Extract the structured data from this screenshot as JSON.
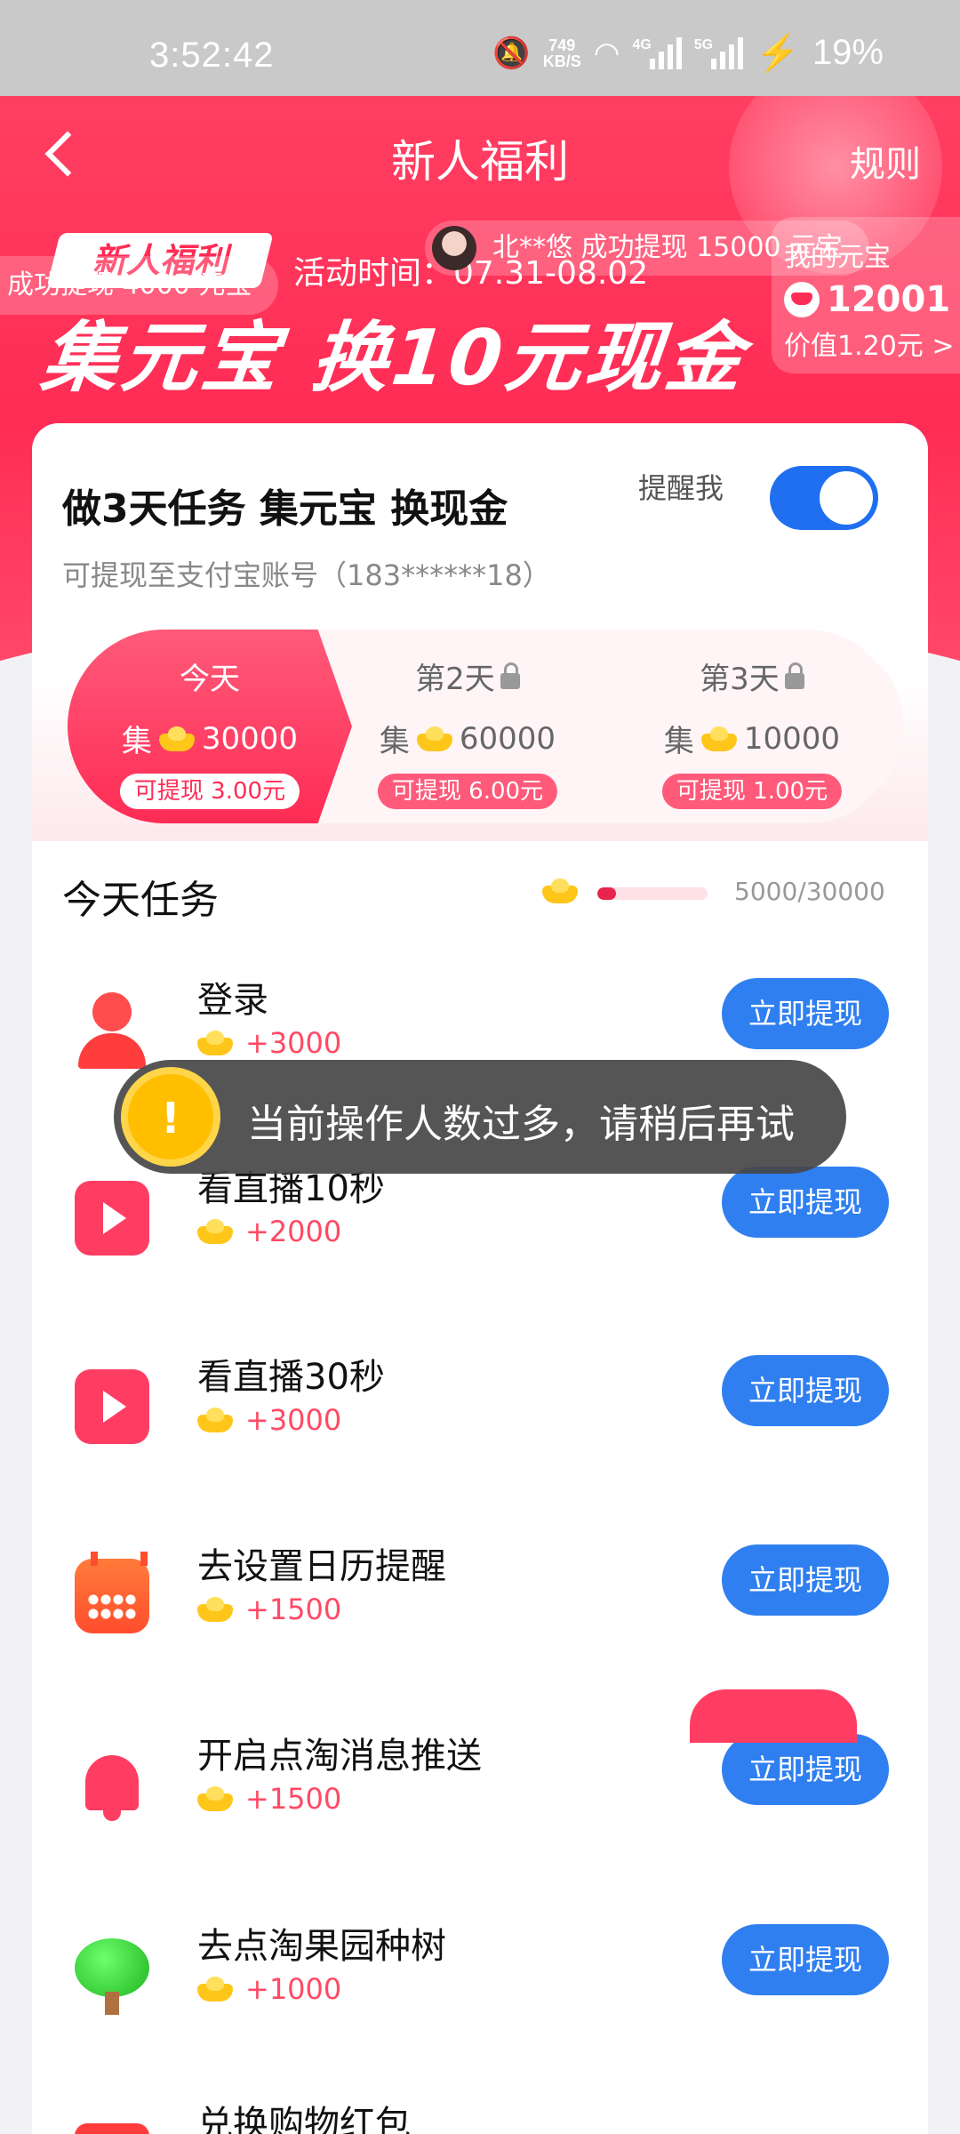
{
  "status_bar": {
    "time": "3:52:42",
    "net_speed_value": "749",
    "net_speed_unit": "KB/S",
    "network_4g": "4G",
    "network_5g": "5G",
    "battery": "19%"
  },
  "header": {
    "title": "新人福利",
    "rules": "规则"
  },
  "banner": {
    "badge": "新人福利",
    "ticker_left": "成功提现 4000 元宝",
    "activity_time": "活动时间：07.31-08.02",
    "ticker_right": "北**悠 成功提现 15000 元宝",
    "headline": "集元宝 换10元现金",
    "my_yuanbao_label": "我的元宝",
    "my_yuanbao_amount": "12001",
    "my_yuanbao_value": "价值1.20元 >"
  },
  "task_card": {
    "title": "做3天任务 集元宝 换现金",
    "subtitle": "可提现至支付宝账号（183******18）",
    "remind_label": "提醒我",
    "remind_on": true,
    "days": [
      {
        "name": "今天",
        "prefix": "集",
        "amount": "30000",
        "cash": "可提现 3.00元",
        "locked": false
      },
      {
        "name": "第2天",
        "prefix": "集",
        "amount": "60000",
        "cash": "可提现 6.00元",
        "locked": true
      },
      {
        "name": "第3天",
        "prefix": "集",
        "amount": "10000",
        "cash": "可提现 1.00元",
        "locked": true
      }
    ],
    "today_tasks_title": "今天任务",
    "progress": {
      "current": 5000,
      "total": 30000,
      "text": "5000/30000"
    }
  },
  "tasks": [
    {
      "name": "登录",
      "reward": "+3000",
      "button": "立即提现",
      "icon": "user-icon"
    },
    {
      "name": "看直播10秒",
      "reward": "+2000",
      "button": "立即提现",
      "icon": "play-icon"
    },
    {
      "name": "看直播30秒",
      "reward": "+3000",
      "button": "立即提现",
      "icon": "play-icon"
    },
    {
      "name": "去设置日历提醒",
      "reward": "+1500",
      "button": "立即提现",
      "icon": "calendar-icon"
    },
    {
      "name": "开启点淘消息推送",
      "reward": "+1500",
      "button": "立即提现",
      "icon": "bell-icon"
    },
    {
      "name": "去点淘果园种树",
      "reward": "+1000",
      "button": "立即提现",
      "icon": "tree-icon"
    },
    {
      "name": "兑换购物红包",
      "reward": "",
      "button": "",
      "icon": "red-packet-icon"
    }
  ],
  "toast": {
    "message": "当前操作人数过多，请稍后再试",
    "icon": "warning-icon"
  },
  "colors": {
    "brand_red": "#ff2c55",
    "button_blue": "#2f7ff0",
    "reward_red": "#ff4a64",
    "toggle_blue": "#1f6ff0"
  }
}
